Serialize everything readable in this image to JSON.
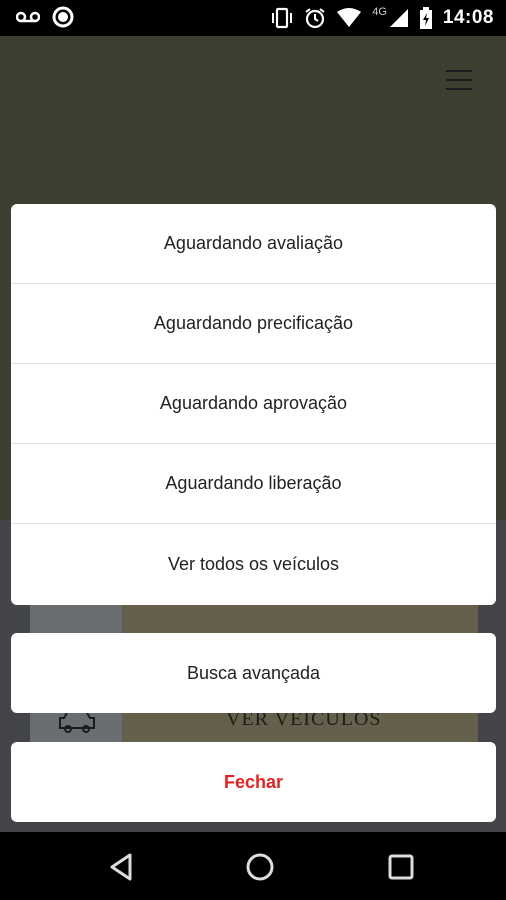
{
  "status_bar": {
    "network": "4G",
    "time": "14:08",
    "icons": [
      "voicemail-icon",
      "circle-icon",
      "vibrate-icon",
      "alarm-icon",
      "wifi-icon",
      "signal-icon",
      "battery-icon"
    ]
  },
  "background": {
    "card_label": "VER VEÍCULOS"
  },
  "action_sheet": {
    "items": [
      {
        "label": "Aguardando avaliação"
      },
      {
        "label": "Aguardando precificação"
      },
      {
        "label": "Aguardando aprovação"
      },
      {
        "label": "Aguardando liberação"
      },
      {
        "label": "Ver todos os veículos"
      }
    ]
  },
  "advanced_search": {
    "label": "Busca avançada"
  },
  "close": {
    "label": "Fechar",
    "color": "#e02424"
  },
  "nav_bar": {
    "icons": [
      "back-icon",
      "home-icon",
      "recents-icon"
    ]
  }
}
